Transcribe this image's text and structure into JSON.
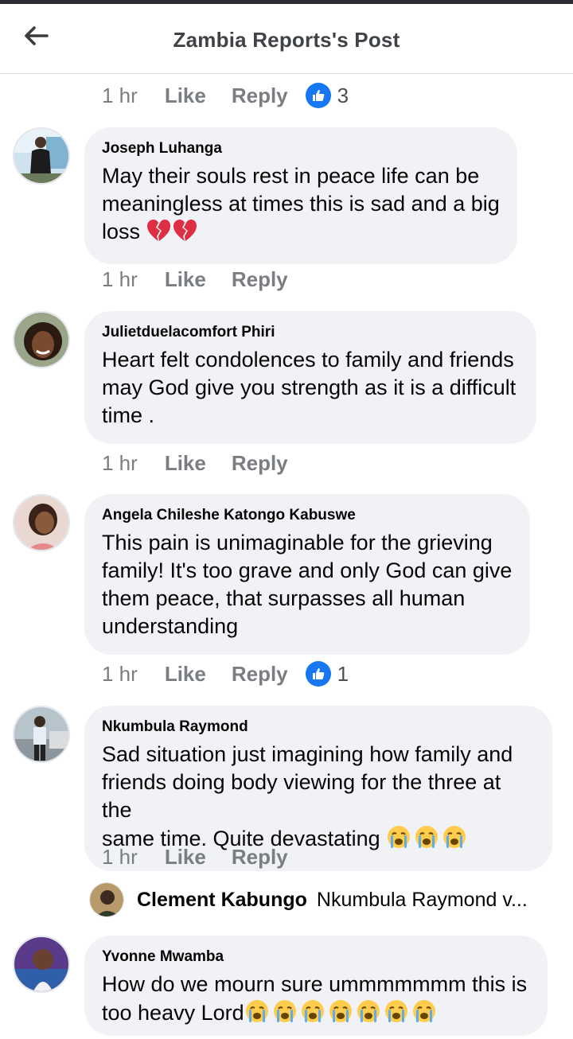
{
  "header": {
    "title": "Zambia Reports's Post",
    "back_icon": "back-arrow-icon"
  },
  "actions": {
    "like": "Like",
    "reply": "Reply"
  },
  "top_meta": {
    "time": "1 hr",
    "reaction_count": "3"
  },
  "comments": [
    {
      "author": "Joseph Luhanga",
      "text": "May their souls rest in peace life can be\nmeaningless at times this is sad and a big\nloss",
      "emoji": "broken-heart x2",
      "time": "1 hr",
      "reaction_count": ""
    },
    {
      "author": "Julietduelacomfort Phiri",
      "text": "Heart felt condolences to family and friends\nmay God give you strength as it is a difficult\ntime .",
      "time": "1 hr",
      "reaction_count": ""
    },
    {
      "author": "Angela Chileshe Katongo Kabuswe",
      "text": "This pain is unimaginable for the grieving\nfamily! It's too grave and only God  can give\nthem peace, that surpasses all human\nunderstanding",
      "time": "1 hr",
      "reaction_count": "1"
    },
    {
      "author": "Nkumbula Raymond",
      "text": "Sad situation just imagining how family and\nfriends doing body viewing for the three at the\nsame time. Quite devastating",
      "emoji": "crying-face x3",
      "time": "1 hr",
      "reaction_count": ""
    },
    {
      "author": "Yvonne Mwamba",
      "text": "How do we mourn sure ummmmmmm this is\ntoo heavy Lord",
      "emoji": "crying-face x7",
      "time": "",
      "reaction_count": ""
    }
  ],
  "reply_preview": {
    "author": "Clement Kabungo",
    "text": "Nkumbula Raymond v..."
  },
  "colors": {
    "bubble": "#f0f2f5",
    "like_blue": "#1877f2",
    "meta_gray": "#7a7d82"
  }
}
